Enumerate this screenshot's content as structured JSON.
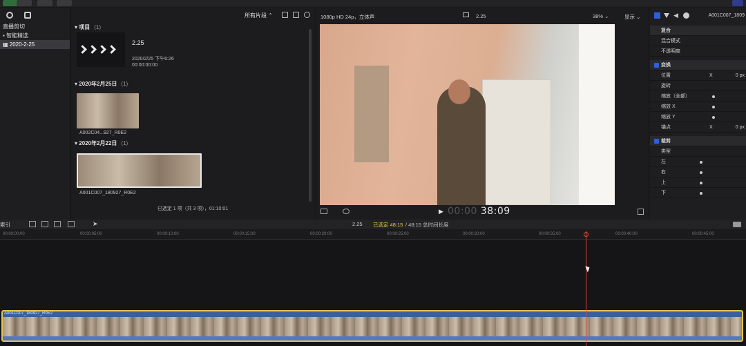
{
  "library": {
    "items": [
      {
        "label": "直播剪切"
      },
      {
        "label": "智能精选"
      },
      {
        "label": "2020-2-25"
      }
    ]
  },
  "browser": {
    "filter": "所有片段 ⌃",
    "sections": [
      {
        "title": "项目",
        "count": "(1)"
      },
      {
        "title": "2020年2月25日",
        "count": "(1)"
      },
      {
        "title": "2020年2月22日",
        "count": "(1)"
      }
    ],
    "project": {
      "name": "2.25",
      "date": "2020/2/25 下午6:26",
      "duration": "00:00:00:00"
    },
    "clips": [
      {
        "label": "A002C04...927_R0E2"
      },
      {
        "label": "A001C007_180927_R0E2"
      }
    ],
    "status": "已选定 1 项（共 3 项），01:10:01"
  },
  "viewer": {
    "format": "1080p HD 24p，立体声",
    "project": "2.25",
    "zoom": "38% ⌄",
    "display": "显示 ⌄",
    "timecode_dim": "00:00",
    "timecode": "38:09"
  },
  "inspector": {
    "clip_name": "A001C007_1809",
    "rows": [
      {
        "label": "复合",
        "section": true
      },
      {
        "label": "混合模式",
        "mid": "",
        "val": ""
      },
      {
        "label": "不透明度",
        "mid": "",
        "val": ""
      },
      {
        "label": "变换",
        "section": true,
        "checked": true
      },
      {
        "label": "位置",
        "mid": "X",
        "val": "0 px"
      },
      {
        "label": "旋转",
        "mid": "",
        "val": ""
      },
      {
        "label": "缩放（全部）",
        "knob": true
      },
      {
        "label": "缩放 X",
        "knob": true
      },
      {
        "label": "缩放 Y",
        "knob": true
      },
      {
        "label": "锚点",
        "mid": "X",
        "val": "0 px"
      },
      {
        "label": "裁剪",
        "section": true,
        "checked": true
      },
      {
        "label": "类型",
        "mid": "",
        "val": ""
      },
      {
        "label": "左",
        "knob": true
      },
      {
        "label": "右",
        "knob": true
      },
      {
        "label": "上",
        "knob": true
      },
      {
        "label": "下",
        "knob": true
      }
    ]
  },
  "timeline": {
    "index_label": "索引",
    "project": "2.25",
    "selection": "已选定 48:15",
    "total": " / 48:15 总时间长度",
    "ticks": [
      "00:00:00:00",
      "00:00:05:00",
      "00:00:10:00",
      "00:00:15:00",
      "00:00:20:00",
      "00:00:25:00",
      "00:00:30:00",
      "00:00:35:00",
      "00:00:40:00",
      "00:00:45:00"
    ],
    "clip_name": "A001C007_180927_R0E2"
  },
  "colors": {
    "accent": "#2c5fd8",
    "playhead": "#e0453a",
    "clip_border": "#e3c64a",
    "clip_fill": "#3b5f9e"
  }
}
